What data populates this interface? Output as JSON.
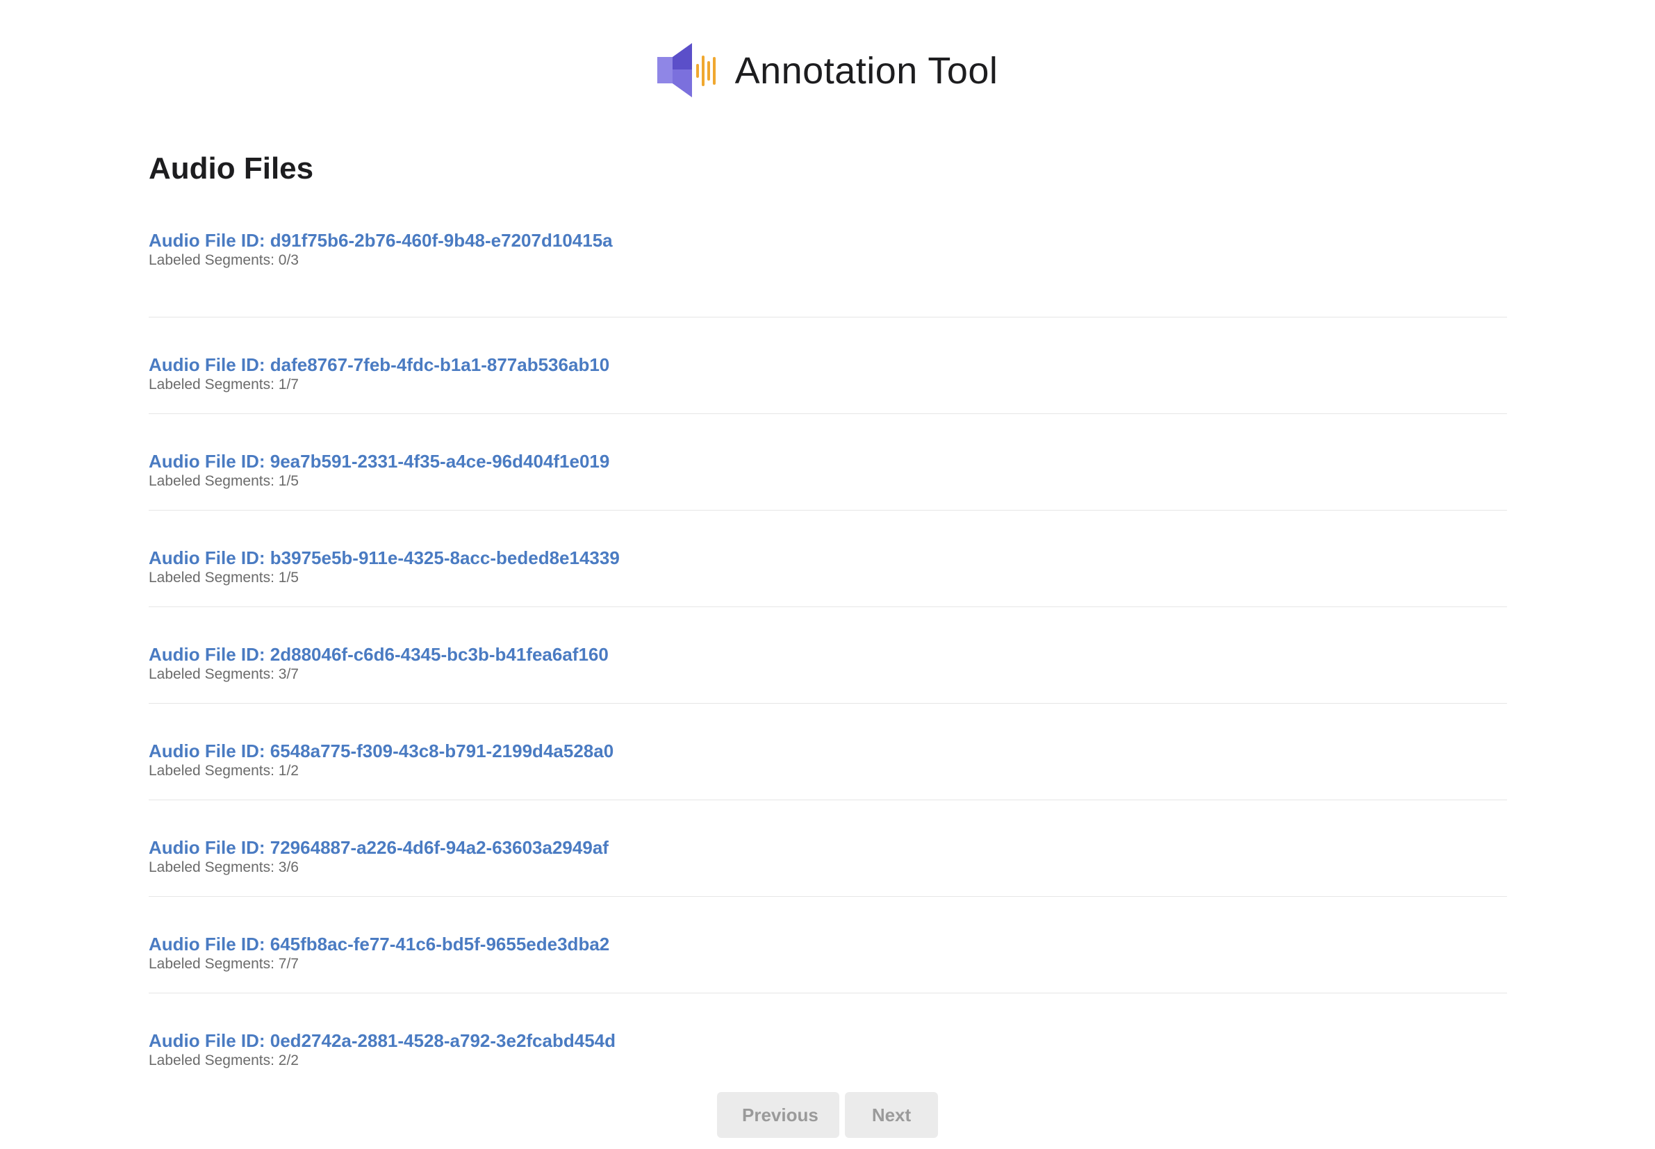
{
  "header": {
    "title": "Annotation Tool",
    "logo_icon": "speaker-soundwave-icon",
    "colors": {
      "speaker_dark": "#5b4fc9",
      "speaker_light": "#8f86e6",
      "wave": "#f0a830"
    }
  },
  "main": {
    "section_title": "Audio Files",
    "files": [
      {
        "label": "Audio File ID: d91f75b6-2b76-460f-9b48-e7207d10415a",
        "segments": "Labeled Segments: 0/3"
      },
      {
        "label": "Audio File ID: dafe8767-7feb-4fdc-b1a1-877ab536ab10",
        "segments": "Labeled Segments: 1/7"
      },
      {
        "label": "Audio File ID: 9ea7b591-2331-4f35-a4ce-96d404f1e019",
        "segments": "Labeled Segments: 1/5"
      },
      {
        "label": "Audio File ID: b3975e5b-911e-4325-8acc-beded8e14339",
        "segments": "Labeled Segments: 1/5"
      },
      {
        "label": "Audio File ID: 2d88046f-c6d6-4345-bc3b-b41fea6af160",
        "segments": "Labeled Segments: 3/7"
      },
      {
        "label": "Audio File ID: 6548a775-f309-43c8-b791-2199d4a528a0",
        "segments": "Labeled Segments: 1/2"
      },
      {
        "label": "Audio File ID: 72964887-a226-4d6f-94a2-63603a2949af",
        "segments": "Labeled Segments: 3/6"
      },
      {
        "label": "Audio File ID: 645fb8ac-fe77-41c6-bd5f-9655ede3dba2",
        "segments": "Labeled Segments: 7/7"
      },
      {
        "label": "Audio File ID: 0ed2742a-2881-4528-a792-3e2fcabd454d",
        "segments": "Labeled Segments: 2/2"
      }
    ]
  },
  "pagination": {
    "previous_label": "Previous",
    "next_label": "Next"
  },
  "theme": {
    "link_color": "#4a7bc2",
    "muted_text": "#6b6b6b",
    "divider": "#e6e6e6",
    "disabled_button_bg": "#ebebeb"
  }
}
